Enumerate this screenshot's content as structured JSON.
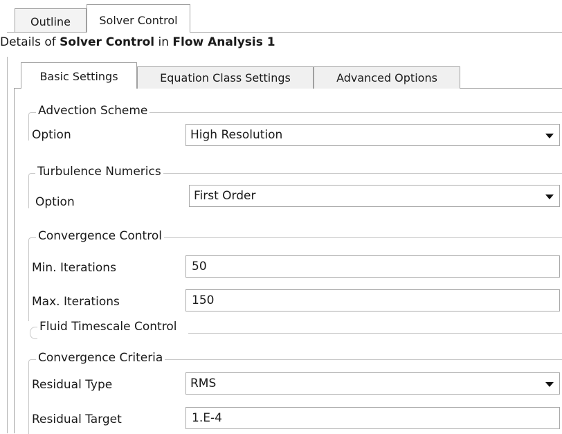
{
  "top_tabs": [
    "Outline",
    "Solver Control"
  ],
  "details": {
    "prefix": "Details of ",
    "object": "Solver Control",
    "middle": " in ",
    "parent": "Flow Analysis 1"
  },
  "inner_tabs": [
    "Basic Settings",
    "Equation Class Settings",
    "Advanced Options"
  ],
  "advection": {
    "title": "Advection Scheme",
    "option_label": "Option",
    "option_value": "High Resolution"
  },
  "turbulence": {
    "title": "Turbulence Numerics",
    "option_label": "Option",
    "option_value": "First Order"
  },
  "convergence_control": {
    "title": "Convergence Control",
    "min_label": "Min. Iterations",
    "min_value": "50",
    "max_label": "Max. Iterations",
    "max_value": "150",
    "fluid_timescale_label": "Fluid Timescale Control"
  },
  "convergence_criteria": {
    "title": "Convergence Criteria",
    "residual_type_label": "Residual Type",
    "residual_type_value": "RMS",
    "residual_target_label": "Residual Target",
    "residual_target_value": "1.E-4"
  },
  "icons": {
    "dropdown": "chevron-down-icon"
  }
}
